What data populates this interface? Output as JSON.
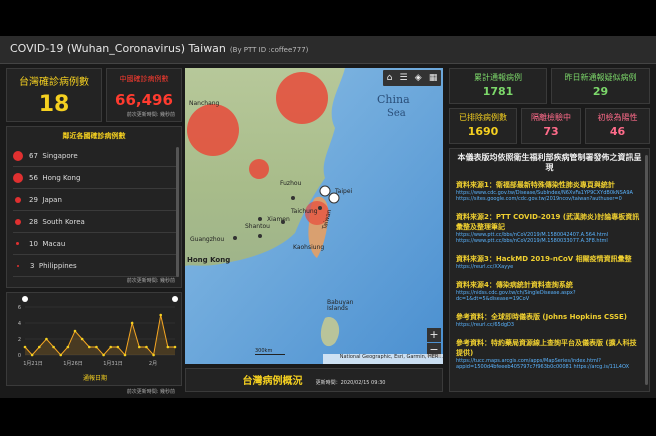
{
  "header": {
    "title": "COVID-19 (Wuhan_Coronavirus) Taiwan",
    "byline": "(By PTT ID :coffee777)"
  },
  "taiwan_cases": {
    "label": "台灣確診病例數",
    "value": "18"
  },
  "china_cases": {
    "label": "中國確診病例數",
    "value": "66,496",
    "note": "前次更新時間: 幾秒前"
  },
  "neighbors": {
    "title": "鄰近各國確診病例數",
    "note": "前次更新時間: 幾秒前",
    "items": [
      {
        "count": "67",
        "name": "Singapore"
      },
      {
        "count": "56",
        "name": "Hong Kong"
      },
      {
        "count": "29",
        "name": "Japan"
      },
      {
        "count": "28",
        "name": "South Korea"
      },
      {
        "count": "10",
        "name": "Macau"
      },
      {
        "count": "3",
        "name": "Philippines"
      }
    ]
  },
  "chart": {
    "title": "通報日期",
    "note": "前次更新時間: 幾秒前"
  },
  "chart_data": {
    "type": "area",
    "x_ticks": [
      "1月21日",
      "1月26日",
      "1月31日",
      "2月"
    ],
    "y_ticks": [
      "0",
      "2",
      "4",
      "6"
    ],
    "ylim": [
      0,
      6
    ],
    "series": [
      {
        "values": [
          1,
          0,
          1,
          2,
          1,
          0,
          1,
          3,
          2,
          1,
          1,
          0,
          1,
          1,
          0,
          4,
          1,
          1,
          0,
          5,
          1,
          1
        ]
      }
    ]
  },
  "map": {
    "labels": [
      "China",
      "Sea",
      "Nanchang",
      "Fuzhou",
      "Xiamen",
      "Shantou",
      "Guangzhou",
      "Hong Kong",
      "Taipei",
      "Taiwan",
      "Taichung",
      "Kaohsiung",
      "Babuyan Islands"
    ],
    "attribution": "National Geographic, Esri, Garmin, HER...",
    "scale": "300km",
    "zoom_in": "+",
    "zoom_out": "−"
  },
  "map_footer": {
    "title": "台灣病例概況",
    "updated": "更新時間：2020/02/15 09:30"
  },
  "stats": {
    "reported_label": "累計通報病例",
    "reported_value": "1781",
    "yesterday_label": "昨日新通報疑似病例",
    "yesterday_value": "29",
    "excluded_label": "已排除病例數",
    "excluded_value": "1690",
    "quarantine_label": "隔離檢驗中",
    "quarantine_value": "73",
    "positive_label": "初檢為陽性",
    "positive_value": "46"
  },
  "info": {
    "heading": "本儀表版均依照衛生福利部疾病管制署發佈之資訊呈現",
    "sources": [
      {
        "title": "資料來源1：衛福部最新特殊傳染性肺炎專頁與統計",
        "link": "https://www.cdc.gov.tw/Disease/SubIndex/N6XvFa1YP9CXYdB0kNSA9A https://sites.google.com/cdc.gov.tw/2019ncov/taiwan?authuser=0"
      },
      {
        "title": "資料來源2：PTT COVID-2019 (武漢肺炎)討論專板資訊彙整及整理筆記",
        "link": "https://www.ptt.cc/bbs/nCoV2019/M.1580042407.A.564.html https://www.ptt.cc/bbs/nCoV2019/M.1580033077.A.3F8.html"
      },
      {
        "title": "資料來源3：HackMD 2019-nCoV 相關疫情資訊彙整",
        "link": "https://reurl.cc/XXayye"
      },
      {
        "title": "資料來源4：傳染病統計資料查詢系統",
        "link": "https://nidss.cdc.gov.tw/ch/SingleDisease.aspx?dc=1&dt=5&disease=19CoV"
      },
      {
        "title": "參考資料：全球即時儀表版 (Johns Hopkins CSSE)",
        "link": "https://reurl.cc/65dgD3"
      },
      {
        "title": "參考資料：特約藥局資源線上查詢平台及儀表版 (擴人科技提供)",
        "link": "https://tucc.maps.arcgis.com/apps/MapSeries/index.html?appid=1500d4bfeeeb405797c7f963b0c00081 https://arcg.is/11L4OX"
      }
    ]
  },
  "colors": {
    "accent_yellow": "#f5d020",
    "accent_red": "#ff3b2f",
    "accent_green": "#7cd86a",
    "accent_pink": "#ff6b8a"
  }
}
